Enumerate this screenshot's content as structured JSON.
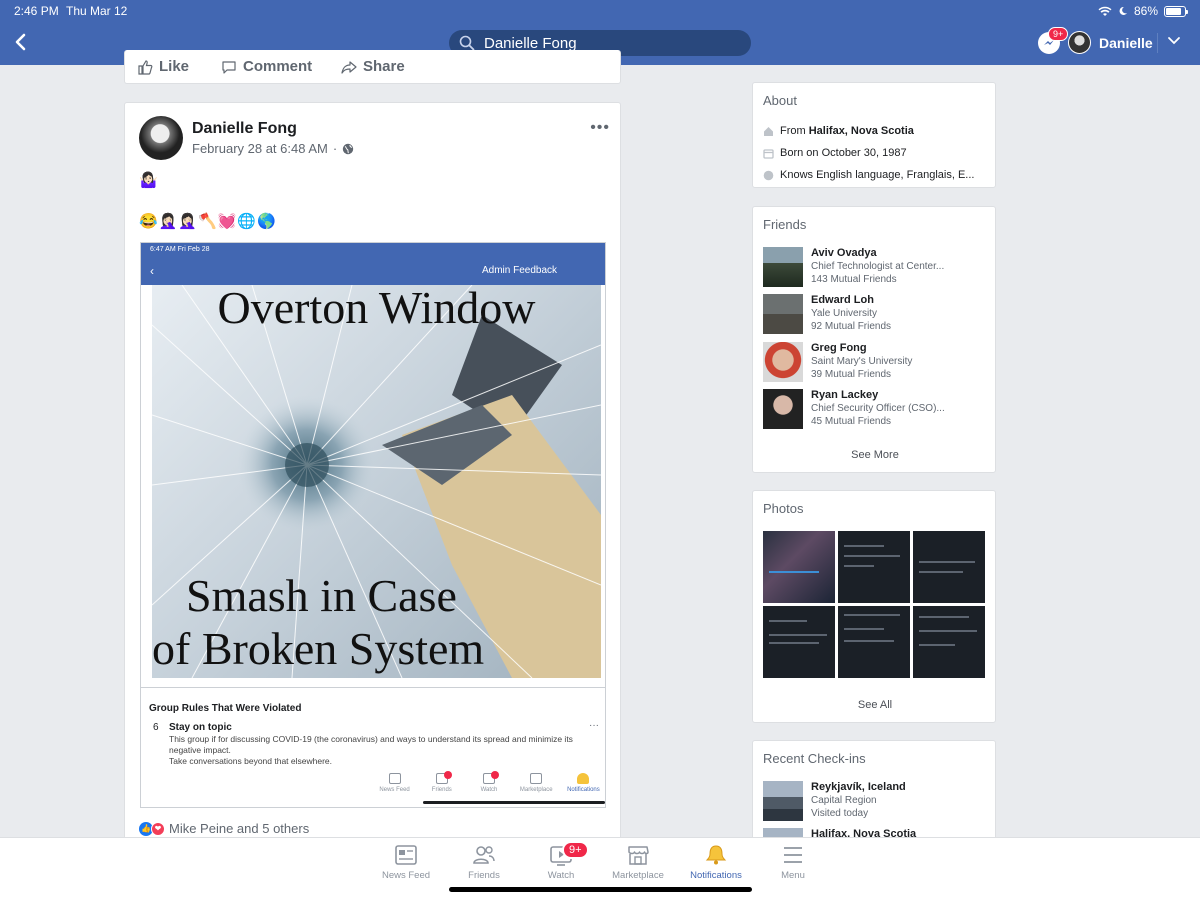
{
  "status_bar": {
    "time": "2:46 PM",
    "date": "Thu Mar 12",
    "battery": "86%"
  },
  "header": {
    "search_value": "Danielle Fong",
    "messenger_badge": "9+",
    "profile_name": "Danielle"
  },
  "previous_post_actions": {
    "like": "Like",
    "comment": "Comment",
    "share": "Share"
  },
  "post": {
    "author": "Danielle Fong",
    "date": "February 28 at 6:48 AM",
    "emoji_line1": "🤷🏻‍♀️",
    "emoji_line2": "😂🤦🏻‍♀️🤦🏻‍♀️🪓💓🌐🌎",
    "screenshot": {
      "time": "6:47 AM  Fri Feb 28",
      "title": "Admin Feedback",
      "image_title": "Overton Window",
      "image_bottom_line1": "Smash in Case",
      "image_bottom_line2": "of Broken System",
      "rules_heading": "Group Rules That Were Violated",
      "rule_number": "6",
      "rule_title": "Stay on topic",
      "rule_text_1": "This group if for discussing COVID-19 (the coronavirus) and ways to understand its spread and minimize its negative impact.",
      "rule_text_2": "Take conversations beyond that elsewhere.",
      "tabs": [
        "News Feed",
        "Friends",
        "Watch",
        "Marketplace",
        "Notifications"
      ]
    },
    "reactions_text": "Mike Peine and 5 others"
  },
  "about": {
    "title": "About",
    "from_prefix": "From ",
    "from_place": "Halifax, Nova Scotia",
    "born": "Born on October 30, 1987",
    "languages": "Knows English language, Franglais, E..."
  },
  "friends": {
    "title": "Friends",
    "items": [
      {
        "name": "Aviv Ovadya",
        "sub": "Chief Technologist at Center...",
        "mutual": "143 Mutual Friends"
      },
      {
        "name": "Edward Loh",
        "sub": "Yale University",
        "mutual": "92 Mutual Friends"
      },
      {
        "name": "Greg Fong",
        "sub": "Saint Mary's University",
        "mutual": "39 Mutual Friends"
      },
      {
        "name": "Ryan Lackey",
        "sub": "Chief Security Officer (CSO)...",
        "mutual": "45 Mutual Friends"
      }
    ],
    "see_more": "See More"
  },
  "photos": {
    "title": "Photos",
    "see_all": "See All"
  },
  "checkins": {
    "title": "Recent Check-ins",
    "items": [
      {
        "name": "Reykjavík, Iceland",
        "sub": "Capital Region",
        "visited": "Visited today"
      },
      {
        "name": "Halifax, Nova Scotia"
      }
    ]
  },
  "tabbar": {
    "news_feed": "News Feed",
    "friends": "Friends",
    "watch": "Watch",
    "watch_badge": "9+",
    "marketplace": "Marketplace",
    "notifications": "Notifications",
    "menu": "Menu"
  },
  "colors": {
    "brand": "#4267b2",
    "badge": "#f02849",
    "background": "#e9ebee"
  }
}
